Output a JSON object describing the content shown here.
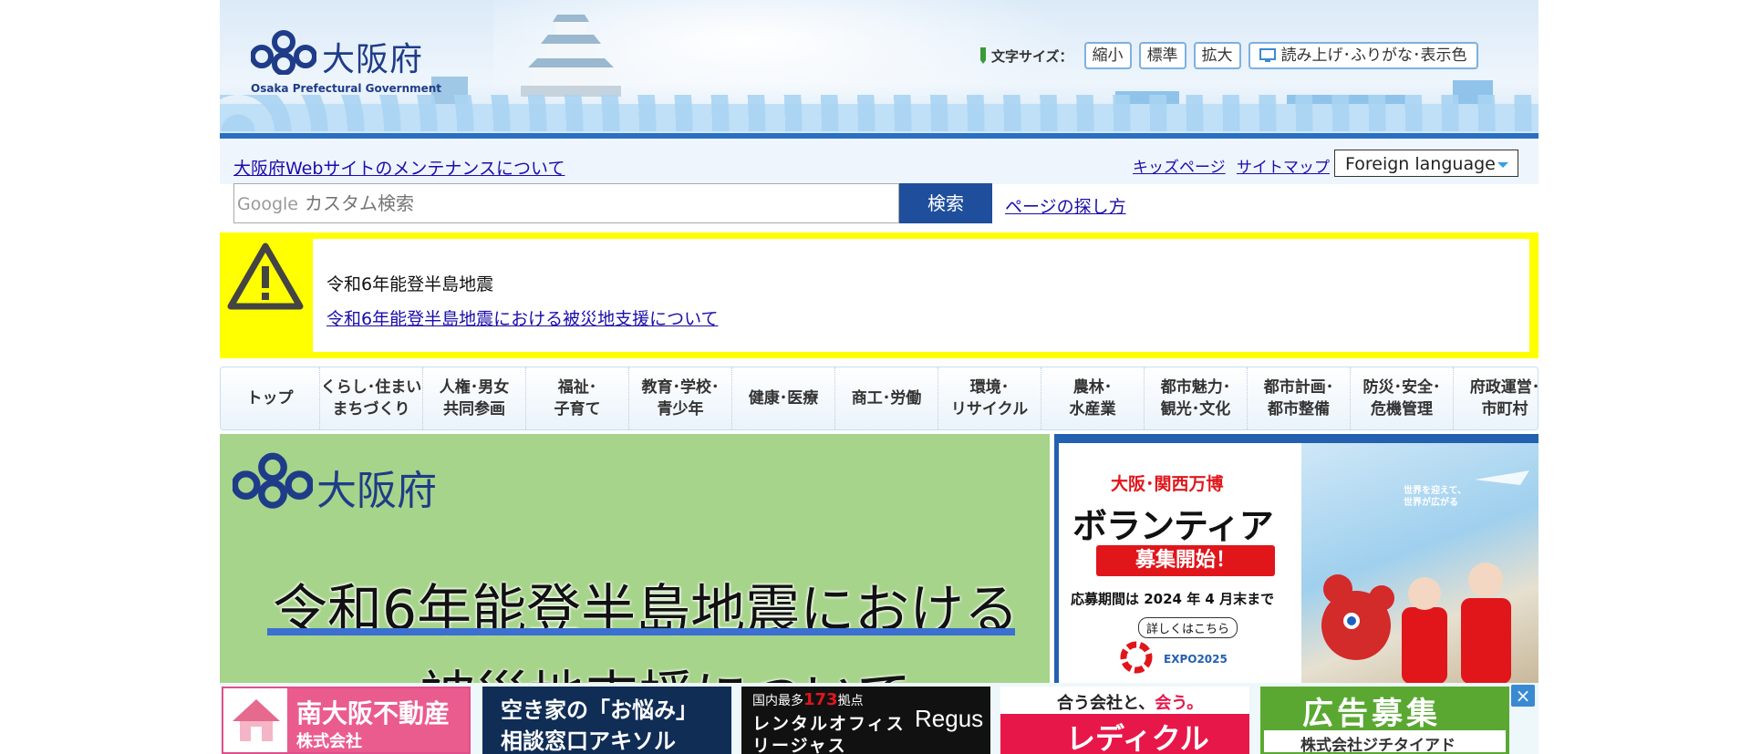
{
  "header": {
    "logo_jp": "大阪府",
    "logo_en": "Osaka Prefectural Government",
    "font_size_label": "文字サイズ：",
    "font_small": "縮小",
    "font_standard": "標準",
    "font_large": "拡大",
    "read_aloud": "読み上げ･ふりがな･表示色"
  },
  "links": {
    "maintenance": "大阪府Webサイトのメンテナンスについて",
    "kids": "キッズページ",
    "sitemap": "サイトマップ",
    "foreign_language": "Foreign language"
  },
  "search": {
    "brand": "Google",
    "placeholder": "カスタム検索",
    "button": "検索",
    "howto": "ページの探し方"
  },
  "alert": {
    "title": "令和6年能登半島地震",
    "link": "令和6年能登半島地震における被災地支援について"
  },
  "nav": {
    "items": [
      [
        "トップ"
      ],
      [
        "くらし･住まい",
        "まちづくり"
      ],
      [
        "人権･男女",
        "共同参画"
      ],
      [
        "福祉･",
        "子育て"
      ],
      [
        "教育･学校･",
        "青少年"
      ],
      [
        "健康･医療"
      ],
      [
        "商工･労働"
      ],
      [
        "環境･",
        "リサイクル"
      ],
      [
        "農林･",
        "水産業"
      ],
      [
        "都市魅力･",
        "観光･文化"
      ],
      [
        "都市計画･",
        "都市整備"
      ],
      [
        "防災･安全･",
        "危機管理"
      ],
      [
        "府政運営･",
        "市町村"
      ]
    ]
  },
  "main_banner": {
    "logo": "大阪府",
    "line1": "令和6年能登半島地震における",
    "line2": "被災地支援について"
  },
  "expo_banner": {
    "title": "大阪･関西万博",
    "headline": "ボランティア",
    "badge": "募集開始！",
    "period": "応募期間は 2024 年 4 月末まで",
    "details": "詳しくはこちら",
    "expo_logo": "EXPO2025",
    "tagline": "世界を迎えて、世界が広がる"
  },
  "ads": {
    "ad1": [
      "南大阪不動産",
      "株式会社"
    ],
    "ad2": [
      "空き家の「お悩み」",
      "相談窓口アキソル"
    ],
    "ad3": [
      "国内最多",
      "173",
      "拠点",
      "レンタルオフィス",
      "リージャス",
      "Regus"
    ],
    "ad4": [
      "合う会社と、",
      "会う。",
      "レディクル"
    ],
    "ad5": [
      "広告募集",
      "株式会社ジチタイアド"
    ],
    "close": "×"
  },
  "colors": {
    "alert_yellow": "#ffff00",
    "search_button": "#1f4e9c",
    "banner_green": "#a6d48a",
    "expo_red": "#e0161b"
  }
}
